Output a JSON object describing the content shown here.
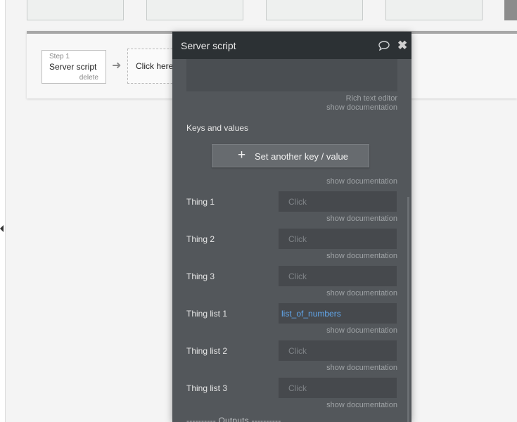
{
  "workflow": {
    "step": {
      "number": "Step 1",
      "title": "Server script",
      "delete_label": "delete"
    },
    "add_step_label": "Click here"
  },
  "editor": {
    "title": "Server script",
    "rich_text_hint": "Rich text editor",
    "doc_link": "show documentation",
    "keys_label": "Keys and values",
    "add_kv_label": "Set another key / value",
    "fields": [
      {
        "label": "Thing 1",
        "value": "",
        "placeholder": "Click"
      },
      {
        "label": "Thing 2",
        "value": "",
        "placeholder": "Click"
      },
      {
        "label": "Thing 3",
        "value": "",
        "placeholder": "Click"
      },
      {
        "label": "Thing list 1",
        "value": "list_of_numbers",
        "placeholder": ""
      },
      {
        "label": "Thing list 2",
        "value": "",
        "placeholder": "Click"
      },
      {
        "label": "Thing list 3",
        "value": "",
        "placeholder": "Click"
      }
    ],
    "outputs_label": "---------- Outputs ----------"
  },
  "icons": {
    "comment": "speech-bubble-icon",
    "close": "close-icon",
    "add": "plus-icon",
    "arrow": "arrow-right-icon"
  },
  "colors": {
    "panel_bg": "#53575b",
    "header_bg": "#2c3134",
    "input_bg": "#46494d",
    "link_blue": "#62a8ee"
  }
}
